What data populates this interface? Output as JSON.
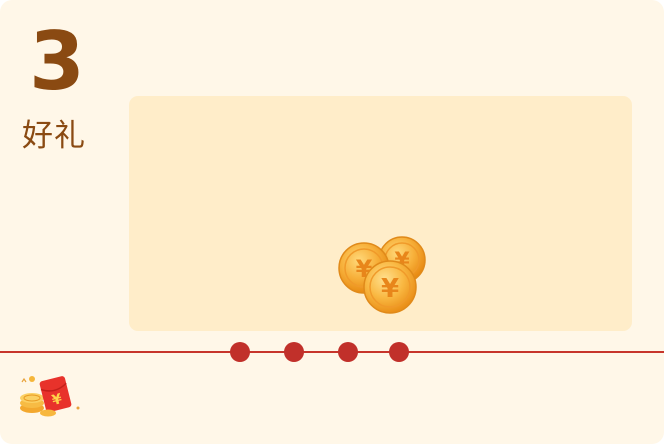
{
  "step": {
    "number": "3",
    "label": "好礼"
  },
  "icons": {
    "coins": "yuan-coins-icon",
    "redpacket": "red-packet-icon"
  },
  "progress": {
    "dots": 4
  },
  "colors": {
    "card_bg": "#fff7e8",
    "panel_bg": "#ffedc9",
    "accent_brown": "#8a4a12",
    "track_red": "#c7352b",
    "coin_gold": "#f5a623"
  }
}
